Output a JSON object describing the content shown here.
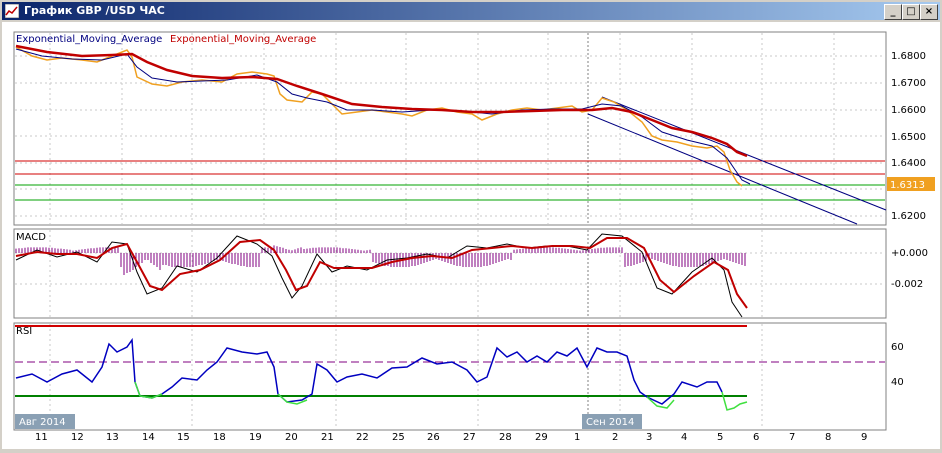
{
  "window": {
    "title": "График GBP /USD  ЧАС",
    "minimize_label": "_",
    "restore_label": "□",
    "close_label": "×"
  },
  "main_panel": {
    "legend_1": "Exponential_Moving_Average",
    "legend_2": "Exponential_Moving_Average",
    "current_price": "1.6313",
    "price_ticks": [
      "1.6800",
      "1.6700",
      "1.6600",
      "1.6500",
      "1.6400",
      "1.6300",
      "1.6200"
    ]
  },
  "macd_panel": {
    "label": "MACD",
    "ticks": [
      "+0.000",
      "-0.002"
    ]
  },
  "rsi_panel": {
    "label": "RSI",
    "ticks": [
      "60",
      "40"
    ]
  },
  "time_axis": {
    "labels": [
      "11",
      "12",
      "13",
      "14",
      "15",
      "18",
      "19",
      "20",
      "21",
      "22",
      "25",
      "26",
      "27",
      "28",
      "29",
      "1",
      "2",
      "3",
      "4",
      "5",
      "6",
      "7",
      "8",
      "9"
    ],
    "month_left": "Авг 2014",
    "month_right": "Сен 2014"
  },
  "colors": {
    "price": "#f0a020",
    "ema_fast": "#000080",
    "ema_slow": "#c00000",
    "support": "#00a000",
    "resistance": "#d00000",
    "channel": "#000080",
    "macd_hist": "#800080",
    "rsi": "#0000c0",
    "rsi_oversold": "#40e040"
  }
}
